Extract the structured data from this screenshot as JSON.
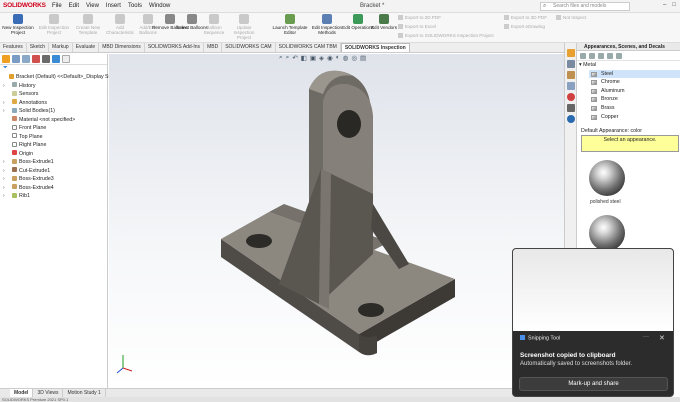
{
  "app": {
    "logo_text": "SOLIDWORKS",
    "menu": [
      "File",
      "Edit",
      "View",
      "Insert",
      "Tools",
      "Window"
    ],
    "title": "Bracket *",
    "search_placeholder": "Search files and models"
  },
  "ribbon": {
    "buttons": [
      {
        "label": "New Inspection Project",
        "enabled": true
      },
      {
        "label": "Edit Inspection Project",
        "enabled": false
      },
      {
        "label": "Create New Template",
        "enabled": false
      },
      {
        "label": "Add Characteristic",
        "enabled": false
      },
      {
        "label": "Add/Edit Balloons",
        "enabled": false
      },
      {
        "label": "Remove Balloons",
        "enabled": true
      },
      {
        "label": "Select Balloons",
        "enabled": true
      },
      {
        "label": "Balloon Sequence",
        "enabled": false
      },
      {
        "label": "Update Inspection Project",
        "enabled": false
      },
      {
        "label": "Launch Template Editor",
        "enabled": true
      },
      {
        "label": "Edit Inspection Methods",
        "enabled": true
      },
      {
        "label": "Edit Operations",
        "enabled": true
      },
      {
        "label": "Edit Vendors",
        "enabled": true
      }
    ],
    "export_pdf": "Export to 2D PDF",
    "export_excel": "Export to Excel",
    "export_project": "Export to SOLIDWORKS Inspection Project",
    "export_3dpdf": "Export to 3D PDF",
    "export_ezdrawing": "Export eDrawing",
    "not_inspected": "Not Inspect"
  },
  "tabs": [
    "Features",
    "Sketch",
    "Markup",
    "Evaluate",
    "MBD Dimensions",
    "SOLIDWORKS Add-Ins",
    "MBD",
    "SOLIDWORKS CAM",
    "SOLIDWORKS CAM TBM",
    "SOLIDWORKS Inspection"
  ],
  "active_tab": "SOLIDWORKS Inspection",
  "tree": {
    "root": "Bracket (Default) <<Default>_Display Sta",
    "items": [
      {
        "label": "History",
        "arrow": "›"
      },
      {
        "label": "Sensors",
        "arrow": ""
      },
      {
        "label": "Annotations",
        "arrow": "›"
      },
      {
        "label": "Solid Bodies(1)",
        "arrow": "›"
      },
      {
        "label": "Material <not specified>",
        "arrow": ""
      },
      {
        "label": "Front Plane",
        "arrow": ""
      },
      {
        "label": "Top Plane",
        "arrow": ""
      },
      {
        "label": "Right Plane",
        "arrow": ""
      },
      {
        "label": "Origin",
        "arrow": ""
      },
      {
        "label": "Boss-Extrude1",
        "arrow": "›"
      },
      {
        "label": "Cut-Extrude1",
        "arrow": "›"
      },
      {
        "label": "Boss-Extrude3",
        "arrow": "›"
      },
      {
        "label": "Boss-Extrude4",
        "arrow": "›"
      },
      {
        "label": "Rib1",
        "arrow": "›"
      }
    ]
  },
  "bottom_tabs": [
    "Model",
    "3D Views",
    "Motion Study 1"
  ],
  "active_bottom_tab": "Model",
  "status_text": "SOLIDWORKS Premium 2021 SP0.1",
  "appearances": {
    "title": "Appearances, Scenes, and Decals",
    "category": "Metal",
    "materials": [
      "Steel",
      "Chrome",
      "Aluminum",
      "Bronze",
      "Brass",
      "Copper"
    ],
    "selected": "Steel",
    "default_label": "Default Appearance: color",
    "select_prompt": "Select an appearance.",
    "swatches": [
      "polished steel"
    ]
  },
  "notification": {
    "app": "Snipping Tool",
    "title": "Screenshot copied to clipboard",
    "body": "Automatically saved to screenshots folder.",
    "action": "Mark-up and share",
    "more": "···",
    "close": "✕"
  }
}
